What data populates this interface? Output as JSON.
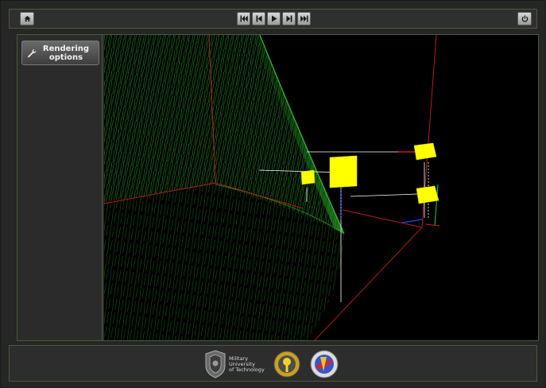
{
  "toolbar": {
    "home_icon": "home-icon",
    "media_controls": [
      "skip-first-icon",
      "step-back-icon",
      "play-icon",
      "step-forward-icon",
      "skip-last-icon"
    ],
    "power_icon": "power-icon"
  },
  "sidebar": {
    "rendering_options_label_line1": "Rendering",
    "rendering_options_label_line2": "options",
    "icon": "wrench-icon"
  },
  "footer": {
    "university_line1": "Military",
    "university_line2": "University",
    "university_line3": "of Technology"
  },
  "colors": {
    "mesh_green": "#1f8a1f",
    "box_yellow": "#ffff00",
    "axis_red": "#c81e1e",
    "panel_border": "#4a5a3a"
  }
}
